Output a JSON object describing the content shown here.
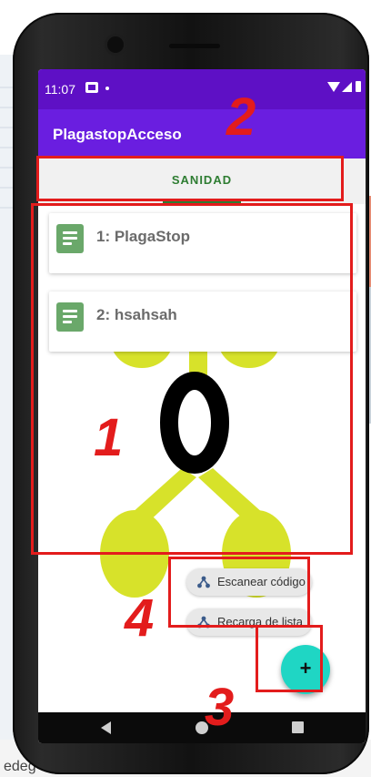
{
  "status_bar": {
    "time": "11:07"
  },
  "app": {
    "title": "PlagastopAcceso"
  },
  "tabs": [
    {
      "label": "SANIDAD"
    }
  ],
  "list": {
    "items": [
      {
        "title": "1: PlagaStop"
      },
      {
        "title": "2: hsahsah"
      }
    ]
  },
  "logo": {
    "letter": "O",
    "leaf_color": "#d7e22a"
  },
  "speed_dial": {
    "actions": [
      {
        "label": "Escanear código"
      },
      {
        "label": "Recarga de lista"
      }
    ],
    "fab_symbol": "+"
  },
  "annotations": {
    "labels": [
      "1",
      "2",
      "3",
      "4"
    ],
    "color": "#e31c1c"
  },
  "background": {
    "bottom_text": "edeg"
  },
  "colors": {
    "status_bar": "#5e10c5",
    "app_bar": "#6a1ee0",
    "tab_accent": "#2e7d32",
    "fab": "#1fd6c4",
    "card_icon": "#6aa86a"
  }
}
